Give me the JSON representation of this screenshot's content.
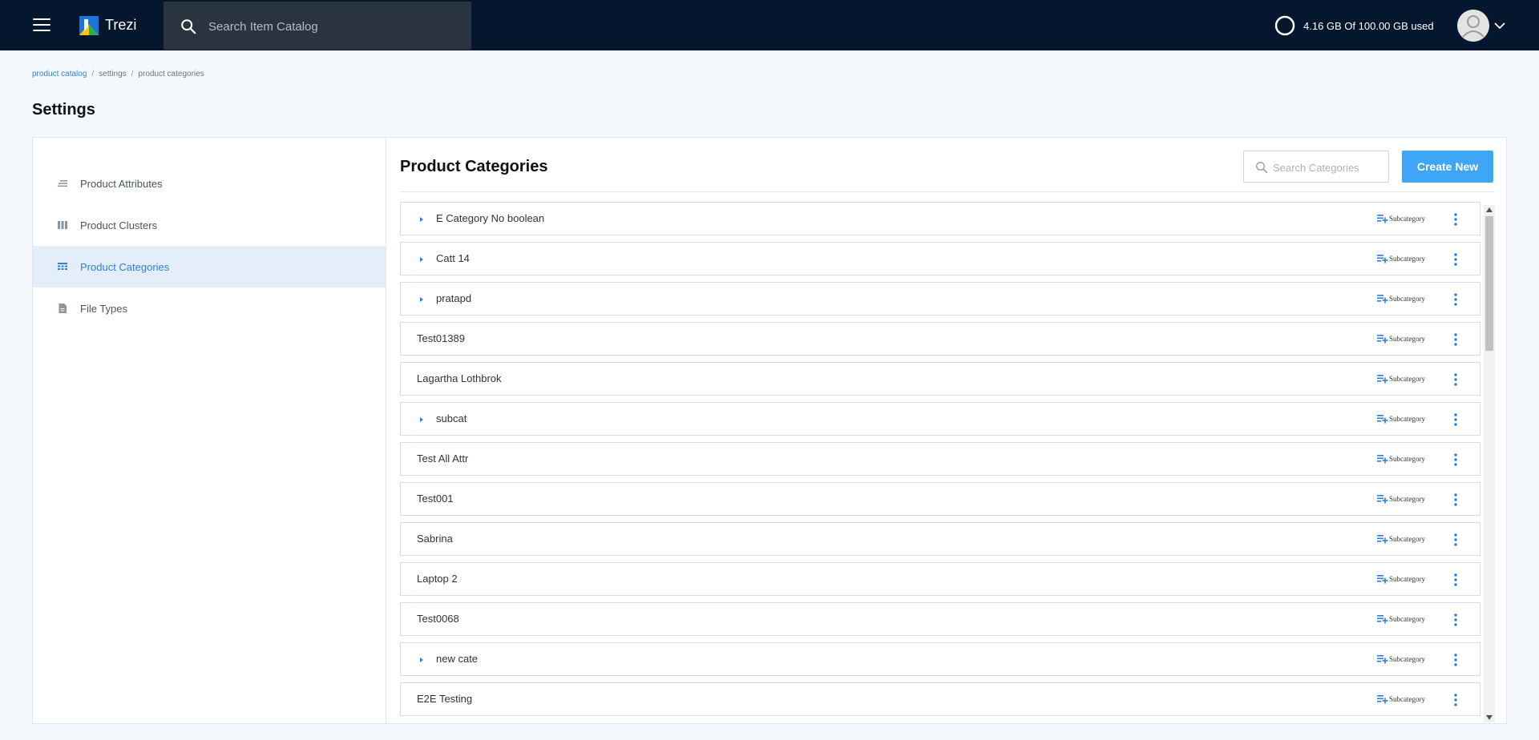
{
  "header": {
    "app_name": "Trezi",
    "search_placeholder": "Search Item Catalog",
    "storage_text": "4.16 GB Of 100.00 GB used"
  },
  "breadcrumb": [
    "product catalog",
    "settings",
    "product categories"
  ],
  "page_title": "Settings",
  "sidebar": {
    "items": [
      {
        "label": "Product Attributes",
        "icon": "attributes-icon",
        "active": false
      },
      {
        "label": "Product Clusters",
        "icon": "clusters-icon",
        "active": false
      },
      {
        "label": "Product Categories",
        "icon": "categories-icon",
        "active": true
      },
      {
        "label": "File Types",
        "icon": "file-icon",
        "active": false
      }
    ]
  },
  "content": {
    "title": "Product Categories",
    "search_placeholder": "Search Categories",
    "create_label": "Create New",
    "subcategory_label": "Subcategory",
    "categories": [
      {
        "name": "E Category No boolean",
        "expandable": true
      },
      {
        "name": "Catt 14",
        "expandable": true
      },
      {
        "name": "pratapd",
        "expandable": true
      },
      {
        "name": "Test01389",
        "expandable": false
      },
      {
        "name": "Lagartha Lothbrok",
        "expandable": false
      },
      {
        "name": "subcat",
        "expandable": true
      },
      {
        "name": "Test All Attr",
        "expandable": false
      },
      {
        "name": "Test001",
        "expandable": false
      },
      {
        "name": "Sabrina",
        "expandable": false
      },
      {
        "name": "Laptop 2",
        "expandable": false
      },
      {
        "name": "Test0068",
        "expandable": false
      },
      {
        "name": "new cate",
        "expandable": true
      },
      {
        "name": "E2E Testing",
        "expandable": false
      }
    ]
  },
  "colors": {
    "topbar": "#04172e",
    "accent": "#2e7fd9",
    "button": "#3fa6f5",
    "active_bg": "#e3eefa"
  }
}
